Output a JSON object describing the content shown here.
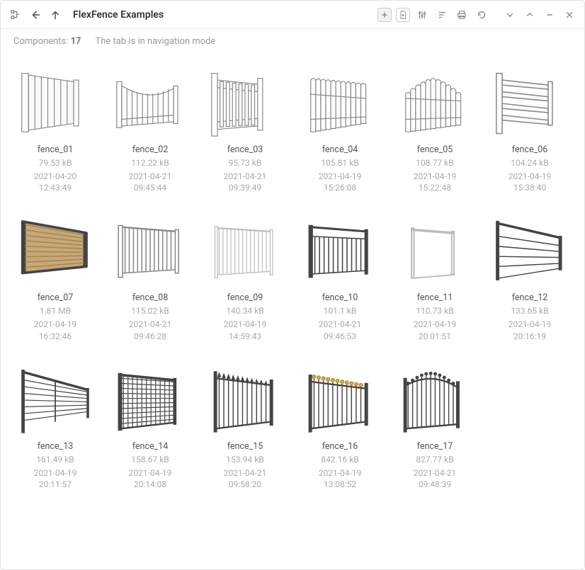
{
  "header": {
    "title": "FlexFence Examples"
  },
  "status": {
    "components_label": "Components:",
    "components_count": "17",
    "mode_text": "The tab is in navigation mode"
  },
  "items": [
    {
      "name": "fence_01",
      "size": "79.53 kB",
      "date": "2021-04-20\n12:43:49",
      "thumb_type": "solid_panel"
    },
    {
      "name": "fence_02",
      "size": "112.22 kB",
      "date": "2021-04-21\n09:45:44",
      "thumb_type": "scallop_picket"
    },
    {
      "name": "fence_03",
      "size": "95.73 kB",
      "date": "2021-04-21\n09:39:49",
      "thumb_type": "picket_gate"
    },
    {
      "name": "fence_04",
      "size": "105.81 kB",
      "date": "2021-04-19\n15:26:08",
      "thumb_type": "round_picket"
    },
    {
      "name": "fence_05",
      "size": "108.77 kB",
      "date": "2021-04-19\n15:22:48",
      "thumb_type": "arch_picket"
    },
    {
      "name": "fence_06",
      "size": "104.24 kB",
      "date": "2021-04-19\n15:38:40",
      "thumb_type": "ranch_rail"
    },
    {
      "name": "fence_07",
      "size": "1.81 MB",
      "date": "2021-04-19\n16:32:46",
      "thumb_type": "wood_slat"
    },
    {
      "name": "fence_08",
      "size": "115.02 kB",
      "date": "2021-04-21\n09:46:28",
      "thumb_type": "rail_bars"
    },
    {
      "name": "fence_09",
      "size": "140.34 kB",
      "date": "2021-04-19\n14:59:43",
      "thumb_type": "rail_thin"
    },
    {
      "name": "fence_10",
      "size": "101.1 kB",
      "date": "2021-04-21\n09:46:53",
      "thumb_type": "rail_dark"
    },
    {
      "name": "fence_11",
      "size": "110.73 kB",
      "date": "2021-04-19\n20:01:51",
      "thumb_type": "frame_only"
    },
    {
      "name": "fence_12",
      "size": "133.65 kB",
      "date": "2021-04-19\n20:16:19",
      "thumb_type": "cable_rail_dark"
    },
    {
      "name": "fence_13",
      "size": "161.49 kB",
      "date": "2021-04-19\n20:11:57",
      "thumb_type": "cable_rail_persp"
    },
    {
      "name": "fence_14",
      "size": "158.67 kB",
      "date": "2021-04-19\n20:14:08",
      "thumb_type": "mesh_grid"
    },
    {
      "name": "fence_15",
      "size": "153.94 kB",
      "date": "2021-04-21\n09:58:20",
      "thumb_type": "wrought_spear"
    },
    {
      "name": "fence_16",
      "size": "842.16 kB",
      "date": "2021-04-19\n13:08:52",
      "thumb_type": "wrought_finial"
    },
    {
      "name": "fence_17",
      "size": "827.77 kB",
      "date": "2021-04-21\n09:48:39",
      "thumb_type": "wrought_arch"
    }
  ]
}
